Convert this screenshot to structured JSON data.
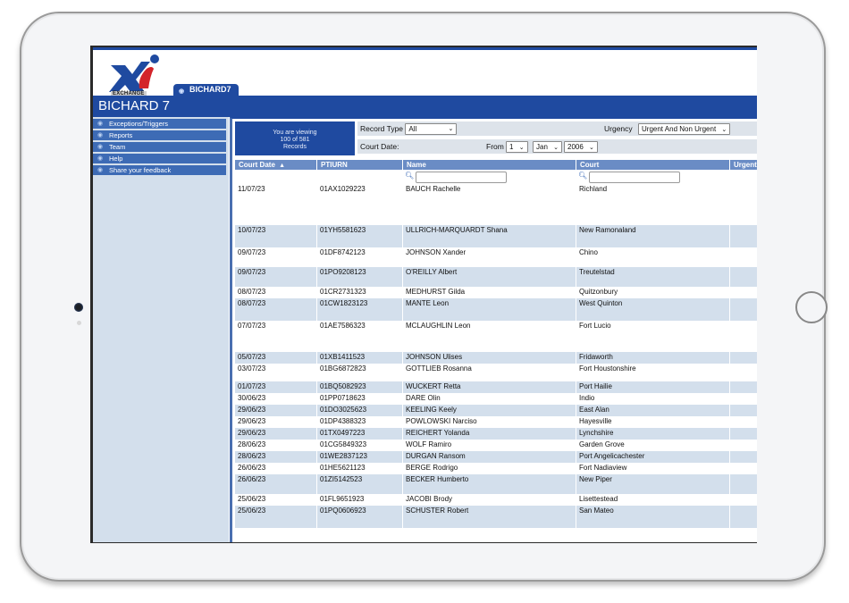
{
  "app": {
    "logo_text": "EXCHANGE",
    "tab_label": "BICHARD7",
    "title": "BICHARD 7"
  },
  "sidebar": {
    "items": [
      {
        "label": "Exceptions/Triggers"
      },
      {
        "label": "Reports"
      },
      {
        "label": "Team"
      },
      {
        "label": "Help"
      },
      {
        "label": "Share your feedback"
      }
    ]
  },
  "summary": {
    "line1": "You are viewing",
    "line2": "100 of 581",
    "line3": "Records"
  },
  "filters": {
    "record_type_label": "Record Type",
    "record_type_value": "All",
    "urgency_label": "Urgency",
    "urgency_value": "Urgent And Non Urgent",
    "court_date_label": "Court Date:",
    "from_label": "From",
    "from_day": "1",
    "from_month": "Jan",
    "from_year": "2006"
  },
  "table": {
    "columns": [
      "Court Date",
      "PTIURN",
      "Name",
      "Court",
      "Urgent"
    ],
    "sort_indicator": "▲",
    "name_search_value": "",
    "court_search_value": "",
    "rows": [
      {
        "date": "11/07/23",
        "ptiurn": "01AX1029223",
        "name": "BAUCH Rachelle",
        "court": "Richland",
        "urgent": false
      },
      {
        "date": "10/07/23",
        "ptiurn": "01YH5581623",
        "name": "ULLRICH-MARQUARDT Shana",
        "court": "New Ramonaland",
        "urgent": true
      },
      {
        "date": "09/07/23",
        "ptiurn": "01DF8742123",
        "name": "JOHNSON Xander",
        "court": "Chino",
        "urgent": false
      },
      {
        "date": "09/07/23",
        "ptiurn": "01PO9208123",
        "name": "O'REILLY Albert",
        "court": "Treutelstad",
        "urgent": false
      },
      {
        "date": "08/07/23",
        "ptiurn": "01CR2731323",
        "name": "MEDHURST Gilda",
        "court": "Quitzonbury",
        "urgent": true
      },
      {
        "date": "08/07/23",
        "ptiurn": "01CW1823123",
        "name": "MANTE Leon",
        "court": "West Quinton",
        "urgent": true
      },
      {
        "date": "07/07/23",
        "ptiurn": "01AE7586323",
        "name": "MCLAUGHLIN Leon",
        "court": "Fort Lucio",
        "urgent": false
      },
      {
        "date": "05/07/23",
        "ptiurn": "01XB1411523",
        "name": "JOHNSON Ulises",
        "court": "Fridaworth",
        "urgent": true
      },
      {
        "date": "03/07/23",
        "ptiurn": "01BG6872823",
        "name": "GOTTLIEB Rosanna",
        "court": "Fort Houstonshire",
        "urgent": true
      },
      {
        "date": "01/07/23",
        "ptiurn": "01BQ5082923",
        "name": "WUCKERT Retta",
        "court": "Port Hailie",
        "urgent": false
      },
      {
        "date": "30/06/23",
        "ptiurn": "01PP0718623",
        "name": "DARE Olin",
        "court": "Indio",
        "urgent": true
      },
      {
        "date": "29/06/23",
        "ptiurn": "01DO3025623",
        "name": "KEELING Keely",
        "court": "East Alan",
        "urgent": true
      },
      {
        "date": "29/06/23",
        "ptiurn": "01DP4388323",
        "name": "POWLOWSKI Narciso",
        "court": "Hayesville",
        "urgent": false
      },
      {
        "date": "29/06/23",
        "ptiurn": "01TX0497223",
        "name": "REICHERT Yolanda",
        "court": "Lynchshire",
        "urgent": true
      },
      {
        "date": "28/06/23",
        "ptiurn": "01CG5849323",
        "name": "WOLF Ramiro",
        "court": "Garden Grove",
        "urgent": true
      },
      {
        "date": "28/06/23",
        "ptiurn": "01WE2837123",
        "name": "DURGAN Ransom",
        "court": "Port Angelicachester",
        "urgent": true
      },
      {
        "date": "26/06/23",
        "ptiurn": "01HE5621123",
        "name": "BERGE Rodrigo",
        "court": "Fort Nadiaview",
        "urgent": true
      },
      {
        "date": "26/06/23",
        "ptiurn": "01ZI5142523",
        "name": "BECKER Humberto",
        "court": "New Piper",
        "urgent": false
      },
      {
        "date": "25/06/23",
        "ptiurn": "01FL9651923",
        "name": "JACOBI Brody",
        "court": "Lisettestead",
        "urgent": true
      },
      {
        "date": "25/06/23",
        "ptiurn": "01PQ0606923",
        "name": "SCHUSTER Robert",
        "court": "San Mateo",
        "urgent": false
      }
    ]
  },
  "colors": {
    "brand_blue": "#1f4aa0",
    "header_blue": "#6a8cc5",
    "row_shade": "#d3dfec",
    "urgent_flag": "#d01010"
  }
}
